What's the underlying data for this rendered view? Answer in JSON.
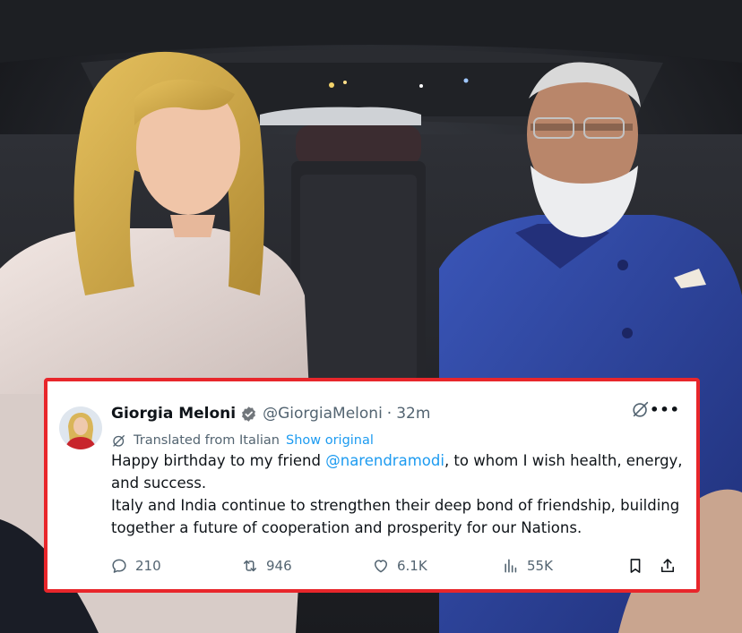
{
  "background_photo": {
    "icon": "photo-two-people-in-car-back-seat"
  },
  "tweet": {
    "author_name": "Giorgia Meloni",
    "handle": "@GiorgiaMeloni",
    "separator": "·",
    "time": "32m",
    "translated_label": "Translated from Italian",
    "show_original_label": "Show original",
    "text_line1_before": "Happy birthday to my friend ",
    "mention": "@narendramodi",
    "text_line1_after": ", to whom I wish health, energy, and success.",
    "text_line2": "Italy and India continue to strengthen their deep bond of friendship, building together a future of cooperation and prosperity for our Nations.",
    "more_label": "•••",
    "stats": {
      "replies": "210",
      "reposts": "946",
      "likes": "6.1K",
      "views": "55K"
    }
  },
  "colors": {
    "card_border": "#e8262b",
    "link": "#1d9bf0",
    "verified_badge": "#71767b",
    "secondary_text": "#536471"
  }
}
